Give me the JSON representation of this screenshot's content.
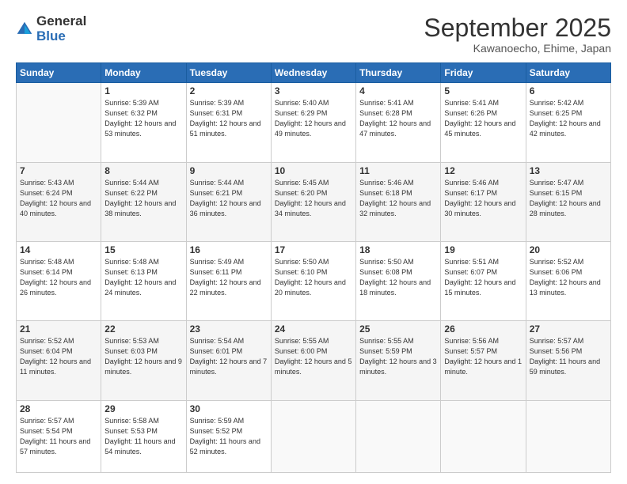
{
  "logo": {
    "line1": "General",
    "line2": "Blue"
  },
  "title": "September 2025",
  "subtitle": "Kawanoecho, Ehime, Japan",
  "header": {
    "days": [
      "Sunday",
      "Monday",
      "Tuesday",
      "Wednesday",
      "Thursday",
      "Friday",
      "Saturday"
    ]
  },
  "weeks": [
    {
      "cells": [
        {
          "day": "",
          "info": ""
        },
        {
          "day": "1",
          "info": "Sunrise: 5:39 AM\nSunset: 6:32 PM\nDaylight: 12 hours\nand 53 minutes."
        },
        {
          "day": "2",
          "info": "Sunrise: 5:39 AM\nSunset: 6:31 PM\nDaylight: 12 hours\nand 51 minutes."
        },
        {
          "day": "3",
          "info": "Sunrise: 5:40 AM\nSunset: 6:29 PM\nDaylight: 12 hours\nand 49 minutes."
        },
        {
          "day": "4",
          "info": "Sunrise: 5:41 AM\nSunset: 6:28 PM\nDaylight: 12 hours\nand 47 minutes."
        },
        {
          "day": "5",
          "info": "Sunrise: 5:41 AM\nSunset: 6:26 PM\nDaylight: 12 hours\nand 45 minutes."
        },
        {
          "day": "6",
          "info": "Sunrise: 5:42 AM\nSunset: 6:25 PM\nDaylight: 12 hours\nand 42 minutes."
        }
      ]
    },
    {
      "cells": [
        {
          "day": "7",
          "info": "Sunrise: 5:43 AM\nSunset: 6:24 PM\nDaylight: 12 hours\nand 40 minutes."
        },
        {
          "day": "8",
          "info": "Sunrise: 5:44 AM\nSunset: 6:22 PM\nDaylight: 12 hours\nand 38 minutes."
        },
        {
          "day": "9",
          "info": "Sunrise: 5:44 AM\nSunset: 6:21 PM\nDaylight: 12 hours\nand 36 minutes."
        },
        {
          "day": "10",
          "info": "Sunrise: 5:45 AM\nSunset: 6:20 PM\nDaylight: 12 hours\nand 34 minutes."
        },
        {
          "day": "11",
          "info": "Sunrise: 5:46 AM\nSunset: 6:18 PM\nDaylight: 12 hours\nand 32 minutes."
        },
        {
          "day": "12",
          "info": "Sunrise: 5:46 AM\nSunset: 6:17 PM\nDaylight: 12 hours\nand 30 minutes."
        },
        {
          "day": "13",
          "info": "Sunrise: 5:47 AM\nSunset: 6:15 PM\nDaylight: 12 hours\nand 28 minutes."
        }
      ]
    },
    {
      "cells": [
        {
          "day": "14",
          "info": "Sunrise: 5:48 AM\nSunset: 6:14 PM\nDaylight: 12 hours\nand 26 minutes."
        },
        {
          "day": "15",
          "info": "Sunrise: 5:48 AM\nSunset: 6:13 PM\nDaylight: 12 hours\nand 24 minutes."
        },
        {
          "day": "16",
          "info": "Sunrise: 5:49 AM\nSunset: 6:11 PM\nDaylight: 12 hours\nand 22 minutes."
        },
        {
          "day": "17",
          "info": "Sunrise: 5:50 AM\nSunset: 6:10 PM\nDaylight: 12 hours\nand 20 minutes."
        },
        {
          "day": "18",
          "info": "Sunrise: 5:50 AM\nSunset: 6:08 PM\nDaylight: 12 hours\nand 18 minutes."
        },
        {
          "day": "19",
          "info": "Sunrise: 5:51 AM\nSunset: 6:07 PM\nDaylight: 12 hours\nand 15 minutes."
        },
        {
          "day": "20",
          "info": "Sunrise: 5:52 AM\nSunset: 6:06 PM\nDaylight: 12 hours\nand 13 minutes."
        }
      ]
    },
    {
      "cells": [
        {
          "day": "21",
          "info": "Sunrise: 5:52 AM\nSunset: 6:04 PM\nDaylight: 12 hours\nand 11 minutes."
        },
        {
          "day": "22",
          "info": "Sunrise: 5:53 AM\nSunset: 6:03 PM\nDaylight: 12 hours\nand 9 minutes."
        },
        {
          "day": "23",
          "info": "Sunrise: 5:54 AM\nSunset: 6:01 PM\nDaylight: 12 hours\nand 7 minutes."
        },
        {
          "day": "24",
          "info": "Sunrise: 5:55 AM\nSunset: 6:00 PM\nDaylight: 12 hours\nand 5 minutes."
        },
        {
          "day": "25",
          "info": "Sunrise: 5:55 AM\nSunset: 5:59 PM\nDaylight: 12 hours\nand 3 minutes."
        },
        {
          "day": "26",
          "info": "Sunrise: 5:56 AM\nSunset: 5:57 PM\nDaylight: 12 hours\nand 1 minute."
        },
        {
          "day": "27",
          "info": "Sunrise: 5:57 AM\nSunset: 5:56 PM\nDaylight: 11 hours\nand 59 minutes."
        }
      ]
    },
    {
      "cells": [
        {
          "day": "28",
          "info": "Sunrise: 5:57 AM\nSunset: 5:54 PM\nDaylight: 11 hours\nand 57 minutes."
        },
        {
          "day": "29",
          "info": "Sunrise: 5:58 AM\nSunset: 5:53 PM\nDaylight: 11 hours\nand 54 minutes."
        },
        {
          "day": "30",
          "info": "Sunrise: 5:59 AM\nSunset: 5:52 PM\nDaylight: 11 hours\nand 52 minutes."
        },
        {
          "day": "",
          "info": ""
        },
        {
          "day": "",
          "info": ""
        },
        {
          "day": "",
          "info": ""
        },
        {
          "day": "",
          "info": ""
        }
      ]
    }
  ]
}
